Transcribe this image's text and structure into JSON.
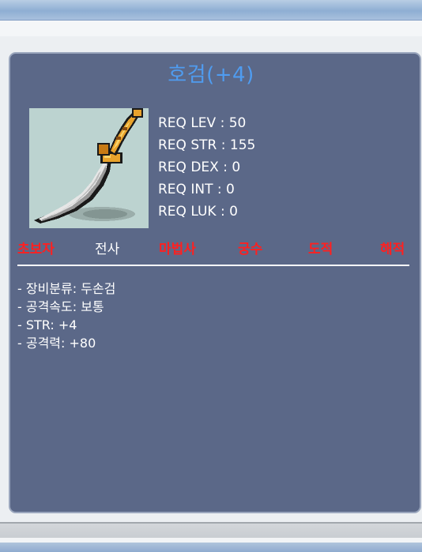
{
  "item": {
    "name": "호검(+4)",
    "icon": "curved-sword-icon"
  },
  "requirements": [
    {
      "label": "REQ LEV",
      "value": "50"
    },
    {
      "label": "REQ STR",
      "value": "155"
    },
    {
      "label": "REQ DEX",
      "value": "0"
    },
    {
      "label": "REQ INT",
      "value": "0"
    },
    {
      "label": "REQ LUK",
      "value": "0"
    }
  ],
  "jobs": [
    {
      "name": "초보자",
      "allowed": false
    },
    {
      "name": "전사",
      "allowed": true
    },
    {
      "name": "마법사",
      "allowed": false
    },
    {
      "name": "궁수",
      "allowed": false
    },
    {
      "name": "도적",
      "allowed": false
    },
    {
      "name": "해적",
      "allowed": false
    }
  ],
  "stats": [
    "- 장비분류: 두손검",
    "- 공격속도: 보통",
    "- STR: +4",
    "- 공격력: +80"
  ],
  "colors": {
    "title": "#4f9cf0",
    "panel": "#5b6888",
    "job_unavailable": "#ff2020",
    "job_available": "#ffffff"
  }
}
